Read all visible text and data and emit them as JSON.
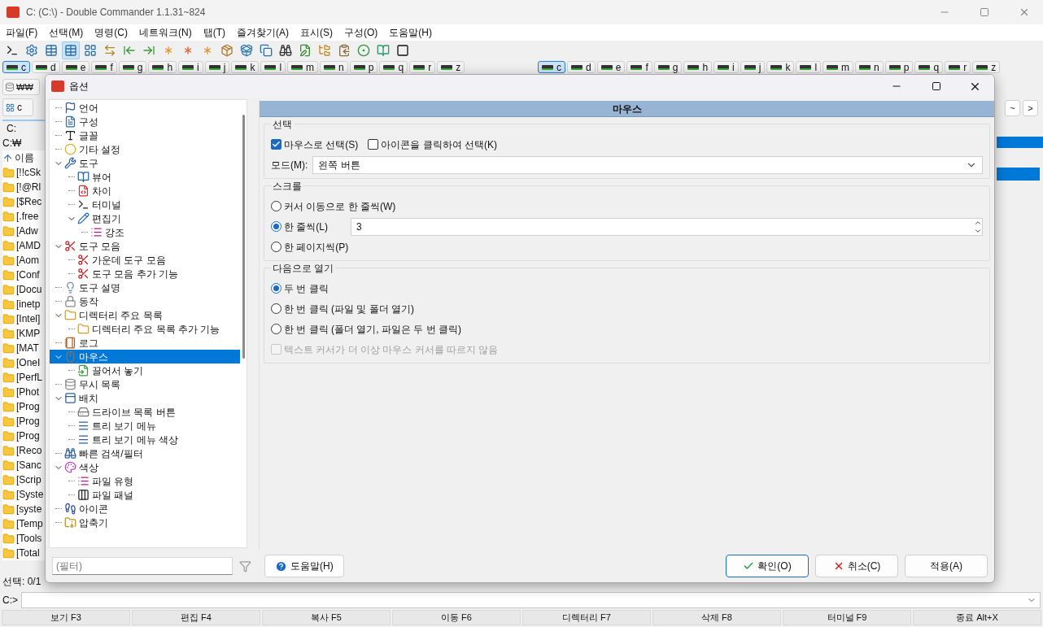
{
  "window": {
    "title": "C: (C:\\) - Double Commander 1.1.31~824"
  },
  "menu": [
    "파일(F)",
    "선택(M)",
    "명령(C)",
    "네트워크(N)",
    "탭(T)",
    "즐겨찾기(A)",
    "표시(S)",
    "구성(O)",
    "도움말(H)"
  ],
  "drive_bars": [
    {
      "drives": [
        {
          "label": "c",
          "selected": true
        },
        {
          "label": "d",
          "selected": false
        },
        {
          "label": "e",
          "selected": false
        },
        {
          "label": "f",
          "selected": false
        },
        {
          "label": "g",
          "selected": false
        },
        {
          "label": "h",
          "selected": false
        },
        {
          "label": "i",
          "selected": false
        },
        {
          "label": "j",
          "selected": false
        },
        {
          "label": "k",
          "selected": false
        },
        {
          "label": "l",
          "selected": false
        },
        {
          "label": "m",
          "selected": false
        },
        {
          "label": "n",
          "selected": false
        },
        {
          "label": "p",
          "selected": false
        },
        {
          "label": "q",
          "selected": false
        },
        {
          "label": "r",
          "selected": false
        },
        {
          "label": "z",
          "selected": false
        }
      ]
    },
    {
      "drives": [
        {
          "label": "c",
          "selected": true
        },
        {
          "label": "d",
          "selected": false
        },
        {
          "label": "e",
          "selected": false
        },
        {
          "label": "f",
          "selected": false
        },
        {
          "label": "g",
          "selected": false
        },
        {
          "label": "h",
          "selected": false
        },
        {
          "label": "i",
          "selected": false
        },
        {
          "label": "j",
          "selected": false
        },
        {
          "label": "k",
          "selected": false
        },
        {
          "label": "l",
          "selected": false
        },
        {
          "label": "m",
          "selected": false
        },
        {
          "label": "n",
          "selected": false
        },
        {
          "label": "p",
          "selected": false
        },
        {
          "label": "q",
          "selected": false
        },
        {
          "label": "r",
          "selected": false
        },
        {
          "label": "z",
          "selected": false
        }
      ]
    }
  ],
  "left_panel": {
    "network_button": "₩₩",
    "drive": "c",
    "path": "C:",
    "current_dir": "C:₩",
    "column": "이름",
    "files": [
      "[!!cSk",
      "[!@Rl",
      "[$Rec",
      "[.free",
      "[Adw",
      "[AMD",
      "[Aom",
      "[Conf",
      "[Docu",
      "[inetp",
      "[Intel]",
      "[KMP",
      "[MAT",
      "[OneI",
      "[PerfL",
      "[Phot",
      "[Prog",
      "[Prog",
      "[Prog",
      "[Reco",
      "[Sanc",
      "[Scrip",
      "[Syste",
      "[syste",
      "[Temp",
      "[Tools",
      "[Total"
    ],
    "status": "선택: 0/1"
  },
  "right_panel": {
    "buttons": [
      "~",
      ">"
    ]
  },
  "dialog": {
    "title": "옵션",
    "tree": [
      {
        "label": "언어",
        "selected": false
      },
      {
        "label": "구성",
        "selected": false
      },
      {
        "label": "글꼴",
        "selected": false
      },
      {
        "label": "기타 설정",
        "selected": false
      },
      {
        "label": "도구",
        "selected": false,
        "expanded": true,
        "children": [
          {
            "label": "뷰어",
            "selected": false
          },
          {
            "label": "차이",
            "selected": false
          },
          {
            "label": "터미널",
            "selected": false
          },
          {
            "label": "편집기",
            "selected": false,
            "expanded": true,
            "children": [
              {
                "label": "강조",
                "selected": false
              }
            ]
          }
        ]
      },
      {
        "label": "도구 모음",
        "selected": false,
        "expanded": true,
        "children": [
          {
            "label": "가운데 도구 모음",
            "selected": false
          },
          {
            "label": "도구 모음 추가 기능",
            "selected": false
          }
        ]
      },
      {
        "label": "도구 설명",
        "selected": false
      },
      {
        "label": "동작",
        "selected": false
      },
      {
        "label": "디렉터리 주요 목록",
        "selected": false,
        "expanded": true,
        "children": [
          {
            "label": "디렉터리 주요 목록 추가 기능",
            "selected": false
          }
        ]
      },
      {
        "label": "로그",
        "selected": false
      },
      {
        "label": "마우스",
        "selected": true,
        "expanded": true,
        "children": [
          {
            "label": "끌어서 놓기",
            "selected": false
          }
        ]
      },
      {
        "label": "무시 목록",
        "selected": false
      },
      {
        "label": "배치",
        "selected": false,
        "expanded": true,
        "children": [
          {
            "label": "드라이브 목록 버튼",
            "selected": false
          },
          {
            "label": "트리 보기 메뉴",
            "selected": false
          },
          {
            "label": "트리 보기 메뉴 색상",
            "selected": false
          }
        ]
      },
      {
        "label": "빠른 검색/필터",
        "selected": false
      },
      {
        "label": "색상",
        "selected": false,
        "expanded": true,
        "children": [
          {
            "label": "파일 유형",
            "selected": false
          },
          {
            "label": "파일 패널",
            "selected": false
          }
        ]
      },
      {
        "label": "아이콘",
        "selected": false
      },
      {
        "label": "압축기",
        "selected": false
      }
    ],
    "page_title": "마우스",
    "groups": [
      {
        "title": "선택",
        "rows": [
          [
            {
              "kind": "checkbox",
              "label": "마우스로 선택(S)",
              "checked": true,
              "disabled": false
            },
            {
              "kind": "checkbox",
              "label": "아이콘을 클릭하여 선택(K)",
              "checked": false,
              "disabled": false
            }
          ],
          [
            {
              "kind": "select",
              "label": "모드(M):",
              "value": "왼쪽 버튼"
            }
          ]
        ]
      },
      {
        "title": "스크롤",
        "rows": [
          [
            {
              "kind": "radio",
              "label": "커서 이동으로 한 줄씩(W)",
              "selected": false
            }
          ],
          [
            {
              "kind": "radio",
              "label": "한 줄씩(L)",
              "selected": true
            },
            {
              "kind": "spin",
              "value": "3"
            }
          ],
          [
            {
              "kind": "radio",
              "label": "한 페이지씩(P)",
              "selected": false
            }
          ]
        ]
      },
      {
        "title": "다음으로 열기",
        "rows": [
          [
            {
              "kind": "radio",
              "label": "두 번 클릭",
              "selected": true
            }
          ],
          [
            {
              "kind": "radio",
              "label": "한 번 클릭 (파일 및 폴더 열기)",
              "selected": false
            }
          ],
          [
            {
              "kind": "radio",
              "label": "한 번 클릭 (폴더 열기, 파일은 두 번 클릭)",
              "selected": false
            }
          ],
          [
            {
              "kind": "checkbox",
              "label": "텍스트 커서가 더 이상 마우스 커서를 따르지 않음",
              "checked": false,
              "disabled": true
            }
          ]
        ]
      }
    ],
    "filter": {
      "placeholder": "(필터)"
    },
    "help_button": "도움말(H)",
    "buttons": [
      {
        "kind": "ok",
        "label": "확인(O)"
      },
      {
        "kind": "cancel",
        "label": "취소(C)"
      },
      {
        "kind": "apply",
        "label": "적용(A)"
      }
    ]
  },
  "command_line": {
    "prompt": "C:>"
  },
  "function_keys": [
    "보기 F3",
    "편집 F4",
    "복사 F5",
    "이동 F6",
    "디렉터리 F7",
    "삭제 F8",
    "터미널 F9",
    "종료 Alt+X"
  ]
}
